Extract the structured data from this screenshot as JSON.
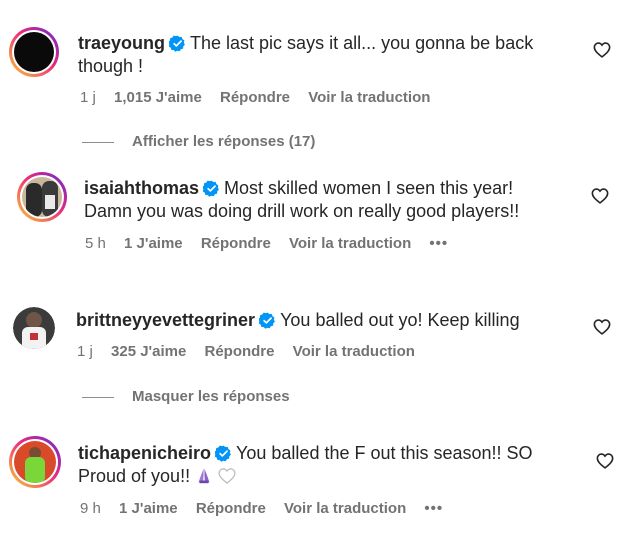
{
  "colors": {
    "text": "#262626",
    "meta": "#737373",
    "verified": "#0095f6",
    "ring_start": "#f9ce34",
    "ring_mid": "#ee2a7b",
    "ring_end": "#6228d7"
  },
  "comments": [
    {
      "username": "traeyoung",
      "verified": true,
      "text": "The last pic says it all... you gonna be back though !",
      "time": "1 j",
      "likes": "1,015 J'aime",
      "reply": "Répondre",
      "translate": "Voir la traduction",
      "avatar": "black-circle"
    },
    {
      "username": "isaiahthomas",
      "verified": true,
      "text": "Most skilled women I seen this year! Damn you was doing drill work on really good players!!",
      "time": "5 h",
      "likes": "1 J'aime",
      "reply": "Répondre",
      "translate": "Voir la traduction",
      "more": "•••",
      "avatar": "two-people-photo"
    },
    {
      "username": "brittneyyevettegriner",
      "verified": true,
      "text": "You balled out yo! Keep killing",
      "time": "1 j",
      "likes": "325 J'aime",
      "reply": "Répondre",
      "translate": "Voir la traduction",
      "avatar": "player-photo"
    },
    {
      "username": "tichapenicheiro",
      "verified": true,
      "text": "You balled the F out this season!! SO Proud of you!!",
      "time": "9 h",
      "likes": "1 J'aime",
      "reply": "Répondre",
      "translate": "Voir la traduction",
      "more": "•••",
      "avatar": "green-outfit-photo"
    }
  ],
  "toggles": {
    "show_replies": "Afficher les réponses (17)",
    "hide_replies": "Masquer les réponses"
  },
  "icons": {
    "verified": "verified-badge-icon",
    "heart": "heart-outline-icon",
    "pray": "pray-emoji-icon",
    "white_heart": "white-heart-emoji-icon"
  }
}
